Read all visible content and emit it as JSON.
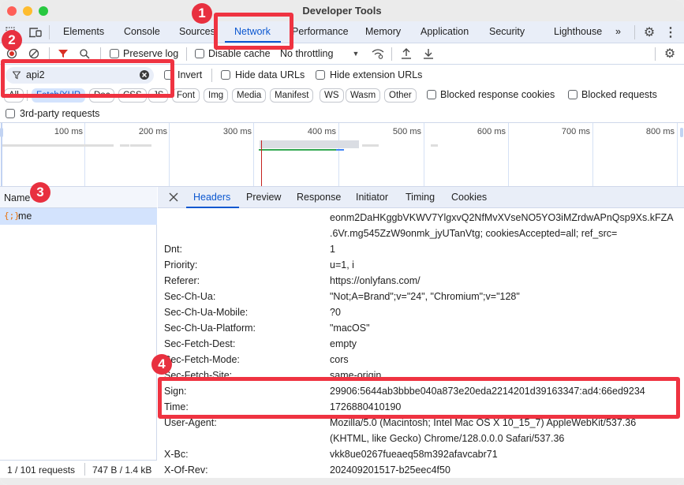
{
  "window": {
    "title": "Developer Tools"
  },
  "panel_tabs": [
    {
      "label": "Elements"
    },
    {
      "label": "Console"
    },
    {
      "label": "Sources"
    },
    {
      "label": "Network",
      "active": true
    },
    {
      "label": "Performance"
    },
    {
      "label": "Memory"
    },
    {
      "label": "Application"
    },
    {
      "label": "Security"
    },
    {
      "label": "Lighthouse"
    }
  ],
  "panel_icons": {
    "more_tabs": "»",
    "settings": "gear-icon",
    "menu": "kebab-icon"
  },
  "toolbar": {
    "preserve_log_label": "Preserve log",
    "disable_cache_label": "Disable cache",
    "throttling_value": "No throttling"
  },
  "filter": {
    "value": "api2",
    "invert_label": "Invert",
    "hide_data_urls_label": "Hide data URLs",
    "hide_extension_urls_label": "Hide extension URLs"
  },
  "type_chips": [
    {
      "label": "All"
    },
    {
      "label": "Fetch/XHR",
      "active": true
    },
    {
      "label": "Doc"
    },
    {
      "label": "CSS"
    },
    {
      "label": "JS"
    },
    {
      "label": "Font"
    },
    {
      "label": "Img"
    },
    {
      "label": "Media"
    },
    {
      "label": "Manifest"
    },
    {
      "label": "WS"
    },
    {
      "label": "Wasm"
    },
    {
      "label": "Other"
    }
  ],
  "extra_filters": {
    "blocked_response_cookies_label": "Blocked response cookies",
    "blocked_requests_label": "Blocked requests",
    "third_party_label": "3rd-party requests"
  },
  "overview": {
    "ticks": [
      "100 ms",
      "200 ms",
      "300 ms",
      "400 ms",
      "500 ms",
      "600 ms",
      "700 ms",
      "800 ms"
    ]
  },
  "requests": {
    "column_name": "Name",
    "rows": [
      {
        "name": "me",
        "selected": true
      }
    ]
  },
  "status": {
    "requests": "1 / 101 requests",
    "transferred": "747 B / 1.4 kB"
  },
  "detail_tabs": [
    {
      "label": "Headers",
      "active": true
    },
    {
      "label": "Preview"
    },
    {
      "label": "Response"
    },
    {
      "label": "Initiator"
    },
    {
      "label": "Timing"
    },
    {
      "label": "Cookies"
    }
  ],
  "cookie_continuation": [
    "eonm2DaHKggbVKWV7YlgxvQ2NfMvXVseNO5YO3iMZrdwAPnQsp9Xs.kFZA",
    ".6Vr.mg545ZzW9onmk_jyUTanVtg; cookiesAccepted=all; ref_src="
  ],
  "request_headers": [
    {
      "key": "Dnt:",
      "value": "1"
    },
    {
      "key": "Priority:",
      "value": "u=1, i"
    },
    {
      "key": "Referer:",
      "value": "https://onlyfans.com/"
    },
    {
      "key": "Sec-Ch-Ua:",
      "value": "\"Not;A=Brand\";v=\"24\", \"Chromium\";v=\"128\""
    },
    {
      "key": "Sec-Ch-Ua-Mobile:",
      "value": "?0"
    },
    {
      "key": "Sec-Ch-Ua-Platform:",
      "value": "\"macOS\""
    },
    {
      "key": "Sec-Fetch-Dest:",
      "value": "empty"
    },
    {
      "key": "Sec-Fetch-Mode:",
      "value": "cors"
    },
    {
      "key": "Sec-Fetch-Site:",
      "value": "same-origin"
    },
    {
      "key": "Sign:",
      "value": "29906:5644ab3bbbe040a873e20eda2214201d39163347:ad4:66ed9234"
    },
    {
      "key": "Time:",
      "value": "1726880410190"
    },
    {
      "key": "User-Agent:",
      "value": "Mozilla/5.0 (Macintosh; Intel Mac OS X 10_15_7) AppleWebKit/537.36",
      "value2": "(KHTML, like Gecko) Chrome/128.0.0.0 Safari/537.36"
    },
    {
      "key": "X-Bc:",
      "value": "vkk8ue0267fueaeq58m392afavcabr71"
    },
    {
      "key": "X-Of-Rev:",
      "value": "202409201517-b25eec4f50"
    }
  ],
  "annotations": [
    "1",
    "2",
    "3",
    "4"
  ],
  "colors": {
    "accent": "#0b57d0",
    "annotation": "#ef3341"
  }
}
